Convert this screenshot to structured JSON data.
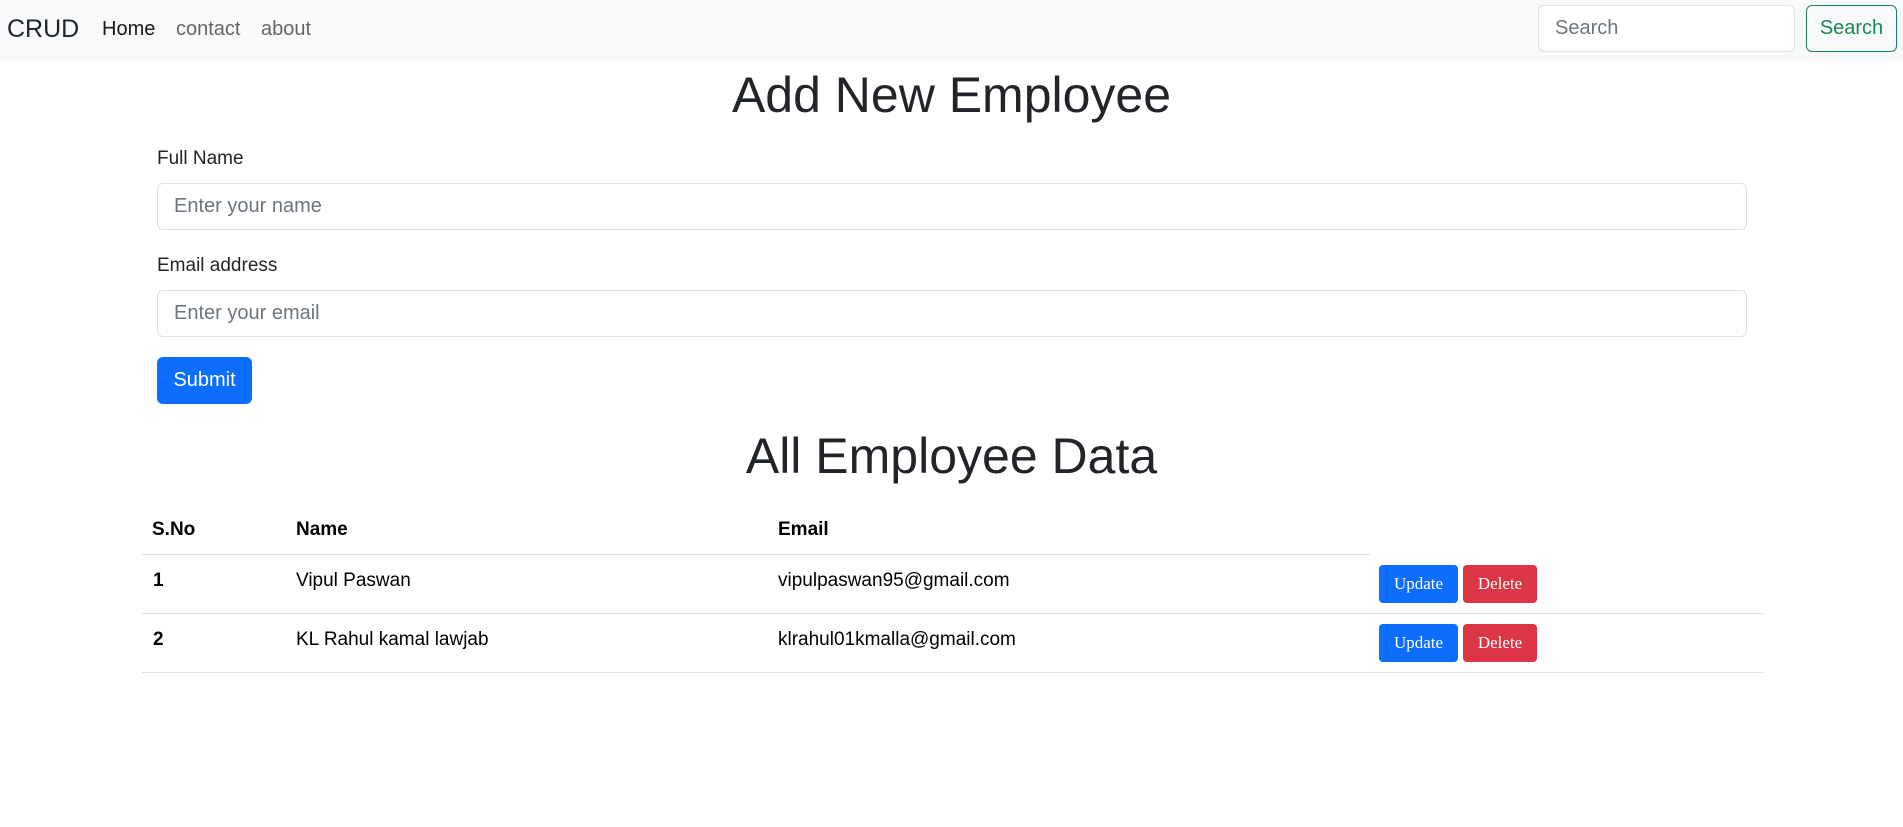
{
  "navbar": {
    "brand": "CRUD",
    "links": [
      {
        "label": "Home",
        "active": true
      },
      {
        "label": "contact",
        "active": false
      },
      {
        "label": "about",
        "active": false
      }
    ],
    "search_placeholder": "Search",
    "search_button": "Search"
  },
  "form": {
    "title": "Add New Employee",
    "name_label": "Full Name",
    "name_placeholder": "Enter your name",
    "email_label": "Email address",
    "email_placeholder": "Enter your email",
    "submit_label": "Submit"
  },
  "table": {
    "title": "All Employee Data",
    "headers": [
      "S.No",
      "Name",
      "Email"
    ],
    "rows": [
      {
        "sno": "1",
        "name": "Vipul Paswan",
        "email": "vipulpaswan95@gmail.com",
        "update": "Update",
        "delete": "Delete"
      },
      {
        "sno": "2",
        "name": "KL Rahul kamal lawjab",
        "email": "klrahul01kmalla@gmail.com",
        "update": "Update",
        "delete": "Delete"
      }
    ]
  },
  "colors": {
    "primary": "#0d6efd",
    "danger": "#dc3545",
    "success": "#198754",
    "navbar_bg": "#f8f9fa"
  }
}
